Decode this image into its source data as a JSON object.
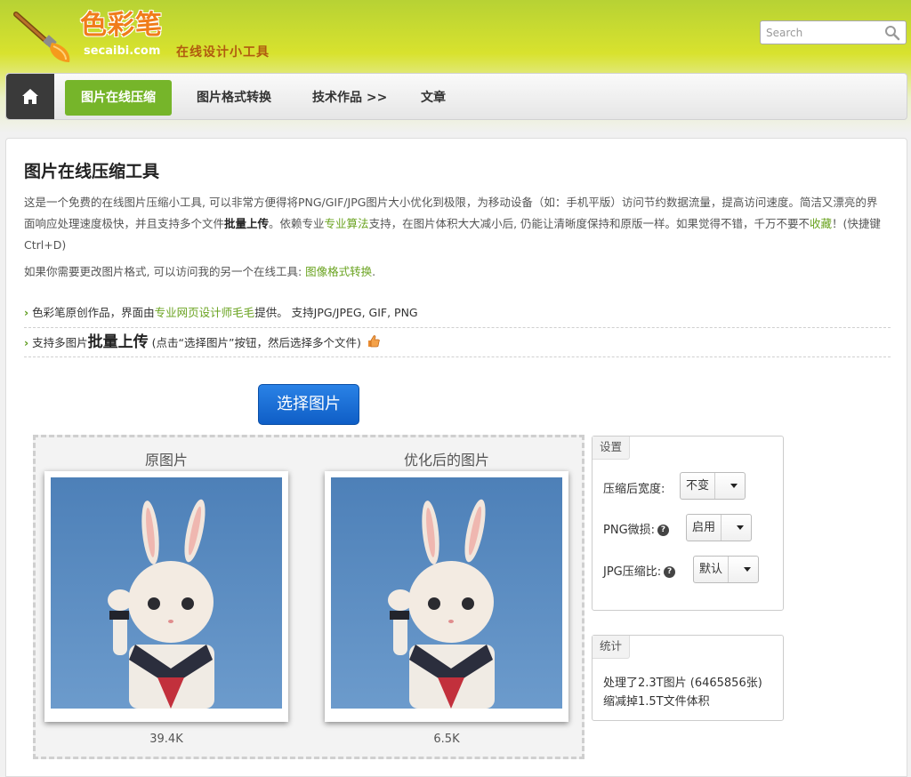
{
  "header": {
    "logo_chars": "色彩笔",
    "logo_domain": "secaibi.com",
    "slogan": "在线设计小工具",
    "search_placeholder": "Search"
  },
  "nav": {
    "home_icon": "home-icon",
    "items": [
      {
        "label": "图片在线压缩",
        "active": true
      },
      {
        "label": "图片格式转换",
        "active": false
      },
      {
        "label": "技术作品 >>",
        "active": false
      },
      {
        "label": "文章",
        "active": false
      }
    ]
  },
  "main": {
    "title": "图片在线压缩工具",
    "desc": {
      "p1": "这是一个免费的在线图片压缩小工具, 可以非常方便得将PNG/GIF/JPG图片大小优化到极限，为移动设备（如：手机平版）访问节约数据流量，提高访问速度。简洁又漂亮的界面响应处理速度极快，并且支持多个文件",
      "bold1": "批量上传",
      "p2": "。依赖专业",
      "link1": "专业算法",
      "p3": "支持，在图片体积大大减小后, 仍能让清晰度保持和原版一样。如果觉得不错，千万不要不",
      "link2": "收藏",
      "p4": "！(快捷键Ctrl+D)"
    },
    "desc2": {
      "text": "如果你需要更改图片格式, 可以访问我的另一个在线工具: ",
      "link": "图像格式转换",
      "end": "."
    },
    "feature1": {
      "t1": "色彩笔原创作品，界面由",
      "link": "专业网页设计师毛毛",
      "t2": "提供。 支持JPG/JPEG, GIF, PNG"
    },
    "feature2": {
      "t1": "支持多图片",
      "big": "批量上传",
      "t2": " (点击“选择图片”按钮，然后选择多个文件)"
    },
    "select_button": "选择图片",
    "original": {
      "label": "原图片",
      "size": "39.4K"
    },
    "optimized": {
      "label": "优化后的图片",
      "size": "6.5K"
    }
  },
  "settings": {
    "title": "设置",
    "width_label": "压缩后宽度:",
    "width_value": "不变",
    "png_label": "PNG微损:",
    "png_value": "启用",
    "jpg_label": "JPG压缩比:",
    "jpg_value": "默认"
  },
  "stats": {
    "title": "统计",
    "line1": "处理了2.3T图片 (6465856张)",
    "line2": "缩减掉1.5T文件体积"
  },
  "colors": {
    "accent_green": "#76b52a",
    "link_green": "#6aa320",
    "button_blue": "#1a6fd6",
    "logo_orange": "#f07c1a"
  }
}
